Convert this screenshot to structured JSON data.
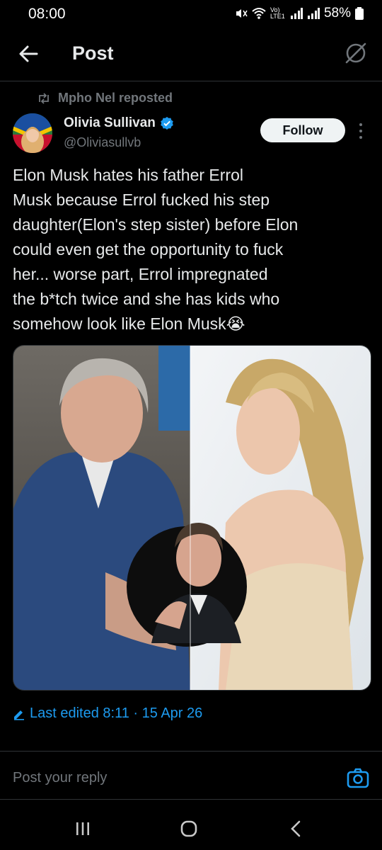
{
  "status": {
    "time": "08:00",
    "network": "Vo) LTE1",
    "battery": "58%"
  },
  "header": {
    "title": "Post"
  },
  "post": {
    "repost_by": "Mpho Nel reposted",
    "author_name": "Olivia Sullivan",
    "author_handle": "@Oliviasullvb",
    "follow_label": "Follow",
    "text": "Elon Musk hates his father Errol\nMusk because Errol fucked his step\ndaughter(Elon's step sister) before Elon\ncould even get the opportunity to fuck\nher... worse part, Errol impregnated\nthe b*tch twice and she has kids who\nsomehow look like Elon Musk😭",
    "edited": "Last edited 8:11 · 15 Apr 26"
  },
  "reply": {
    "placeholder": "Post your reply"
  },
  "colors": {
    "accent": "#1d9bf0",
    "background": "#000000",
    "muted": "#71767b"
  }
}
